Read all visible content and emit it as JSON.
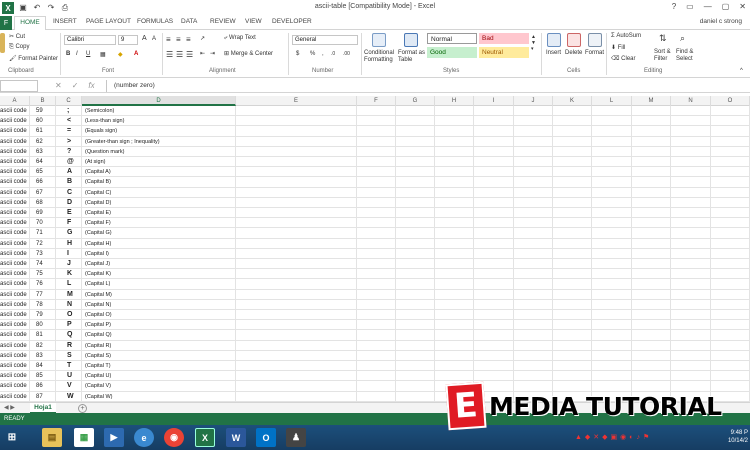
{
  "title_bar": {
    "title": "ascii-table  [Compatibility Mode] - Excel",
    "app_icon": "X",
    "win_help": "?",
    "win_ribbon": "▭",
    "win_min": "—",
    "win_max": "▢",
    "win_close": "✕"
  },
  "tabs": [
    "FILE",
    "HOME",
    "INSERT",
    "PAGE LAYOUT",
    "FORMULAS",
    "DATA",
    "REVIEW",
    "VIEW",
    "DEVELOPER"
  ],
  "file_tab": "F",
  "user": "daniel c strong",
  "ribbon": {
    "clipboard": {
      "cut": "Cut",
      "copy": "Copy",
      "format_painter": "Format Painter",
      "label": "Clipboard"
    },
    "font": {
      "font_name": "Calibri",
      "font_size": "9",
      "label": "Font",
      "bold": "B",
      "italic": "I",
      "underline": "U",
      "grow": "A",
      "shrink": "A"
    },
    "alignment": {
      "wrap_text": "Wrap Text",
      "merge_center": "Merge & Center",
      "label": "Alignment"
    },
    "number": {
      "format": "General",
      "currency": "$",
      "percent": "%",
      "comma": ",",
      "inc": ".0",
      "dec": ".00",
      "label": "Number"
    },
    "styles": {
      "conditional": "Conditional Formatting",
      "format_table": "Format as Table",
      "normal": "Normal",
      "bad": "Bad",
      "good": "Good",
      "neutral": "Neutral",
      "label": "Styles"
    },
    "cells": {
      "insert": "Insert",
      "delete": "Delete",
      "format": "Format",
      "label": "Cells"
    },
    "editing": {
      "autosum": "AutoSum",
      "fill": "Fill",
      "clear": "Clear",
      "sort_filter": "Sort & Filter",
      "find_select": "Find & Select",
      "label": "Editing"
    }
  },
  "formula_bar": {
    "fx": "fx",
    "value": "(number zero)"
  },
  "columns": [
    "A",
    "B",
    "C",
    "D",
    "E",
    "F",
    "G",
    "H",
    "I",
    "J",
    "K",
    "L",
    "M",
    "N",
    "O"
  ],
  "rows": [
    [
      "ascii code",
      "59",
      ";",
      "(Semicolon)"
    ],
    [
      "ascii code",
      "60",
      "<",
      "(Less-than sign)"
    ],
    [
      "ascii code",
      "61",
      "=",
      "(Equals sign)"
    ],
    [
      "ascii code",
      "62",
      ">",
      "(Greater-than sign ; Inequality)"
    ],
    [
      "ascii code",
      "63",
      "?",
      "(Question mark)"
    ],
    [
      "ascii code",
      "64",
      "@",
      "(At sign)"
    ],
    [
      "ascii code",
      "65",
      "A",
      "(Capital A)"
    ],
    [
      "ascii code",
      "66",
      "B",
      "(Capital B)"
    ],
    [
      "ascii code",
      "67",
      "C",
      "(Capital C)"
    ],
    [
      "ascii code",
      "68",
      "D",
      "(Capital D)"
    ],
    [
      "ascii code",
      "69",
      "E",
      "(Capital E)"
    ],
    [
      "ascii code",
      "70",
      "F",
      "(Capital F)"
    ],
    [
      "ascii code",
      "71",
      "G",
      "(Capital G)"
    ],
    [
      "ascii code",
      "72",
      "H",
      "(Capital H)"
    ],
    [
      "ascii code",
      "73",
      "I",
      "(Capital I)"
    ],
    [
      "ascii code",
      "74",
      "J",
      "(Capital J)"
    ],
    [
      "ascii code",
      "75",
      "K",
      "(Capital K)"
    ],
    [
      "ascii code",
      "76",
      "L",
      "(Capital L)"
    ],
    [
      "ascii code",
      "77",
      "M",
      "(Capital M)"
    ],
    [
      "ascii code",
      "78",
      "N",
      "(Capital N)"
    ],
    [
      "ascii code",
      "79",
      "O",
      "(Capital O)"
    ],
    [
      "ascii code",
      "80",
      "P",
      "(Capital P)"
    ],
    [
      "ascii code",
      "81",
      "Q",
      "(Capital Q)"
    ],
    [
      "ascii code",
      "82",
      "R",
      "(Capital R)"
    ],
    [
      "ascii code",
      "83",
      "S",
      "(Capital S)"
    ],
    [
      "ascii code",
      "84",
      "T",
      "(Capital T)"
    ],
    [
      "ascii code",
      "85",
      "U",
      "(Capital U)"
    ],
    [
      "ascii code",
      "86",
      "V",
      "(Capital V)"
    ],
    [
      "ascii code",
      "87",
      "W",
      "(Capital W)"
    ]
  ],
  "sheet": {
    "name": "Hoja1",
    "add": "+"
  },
  "status": {
    "left": "READY"
  },
  "taskbar": {
    "time": "9:48 P",
    "date": "10/14/2"
  },
  "watermark": {
    "letter": "E",
    "text": "MEDIA TUTORIAL"
  },
  "colors": {
    "excel_green": "#217346",
    "bad_bg": "#ffc7ce",
    "good_bg": "#c6efce",
    "neutral_bg": "#ffeb9c"
  }
}
